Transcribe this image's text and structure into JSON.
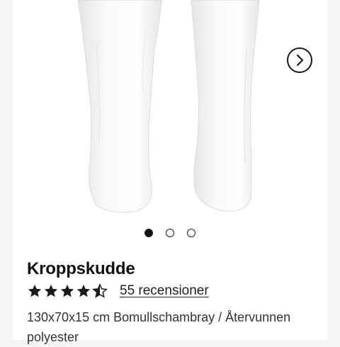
{
  "product": {
    "title": "Kroppskudde",
    "rating": 4.5,
    "rating_max": 5,
    "reviews_label": "55 recensioner",
    "description": "130x70x15 cm Bomullschambray / Återvunnen polyester"
  },
  "gallery": {
    "image_count": 3,
    "active_index": 0,
    "next_icon": "chevron-right-icon"
  },
  "colors": {
    "background": "#f5f5f5",
    "card": "#ffffff",
    "text": "#111111"
  }
}
